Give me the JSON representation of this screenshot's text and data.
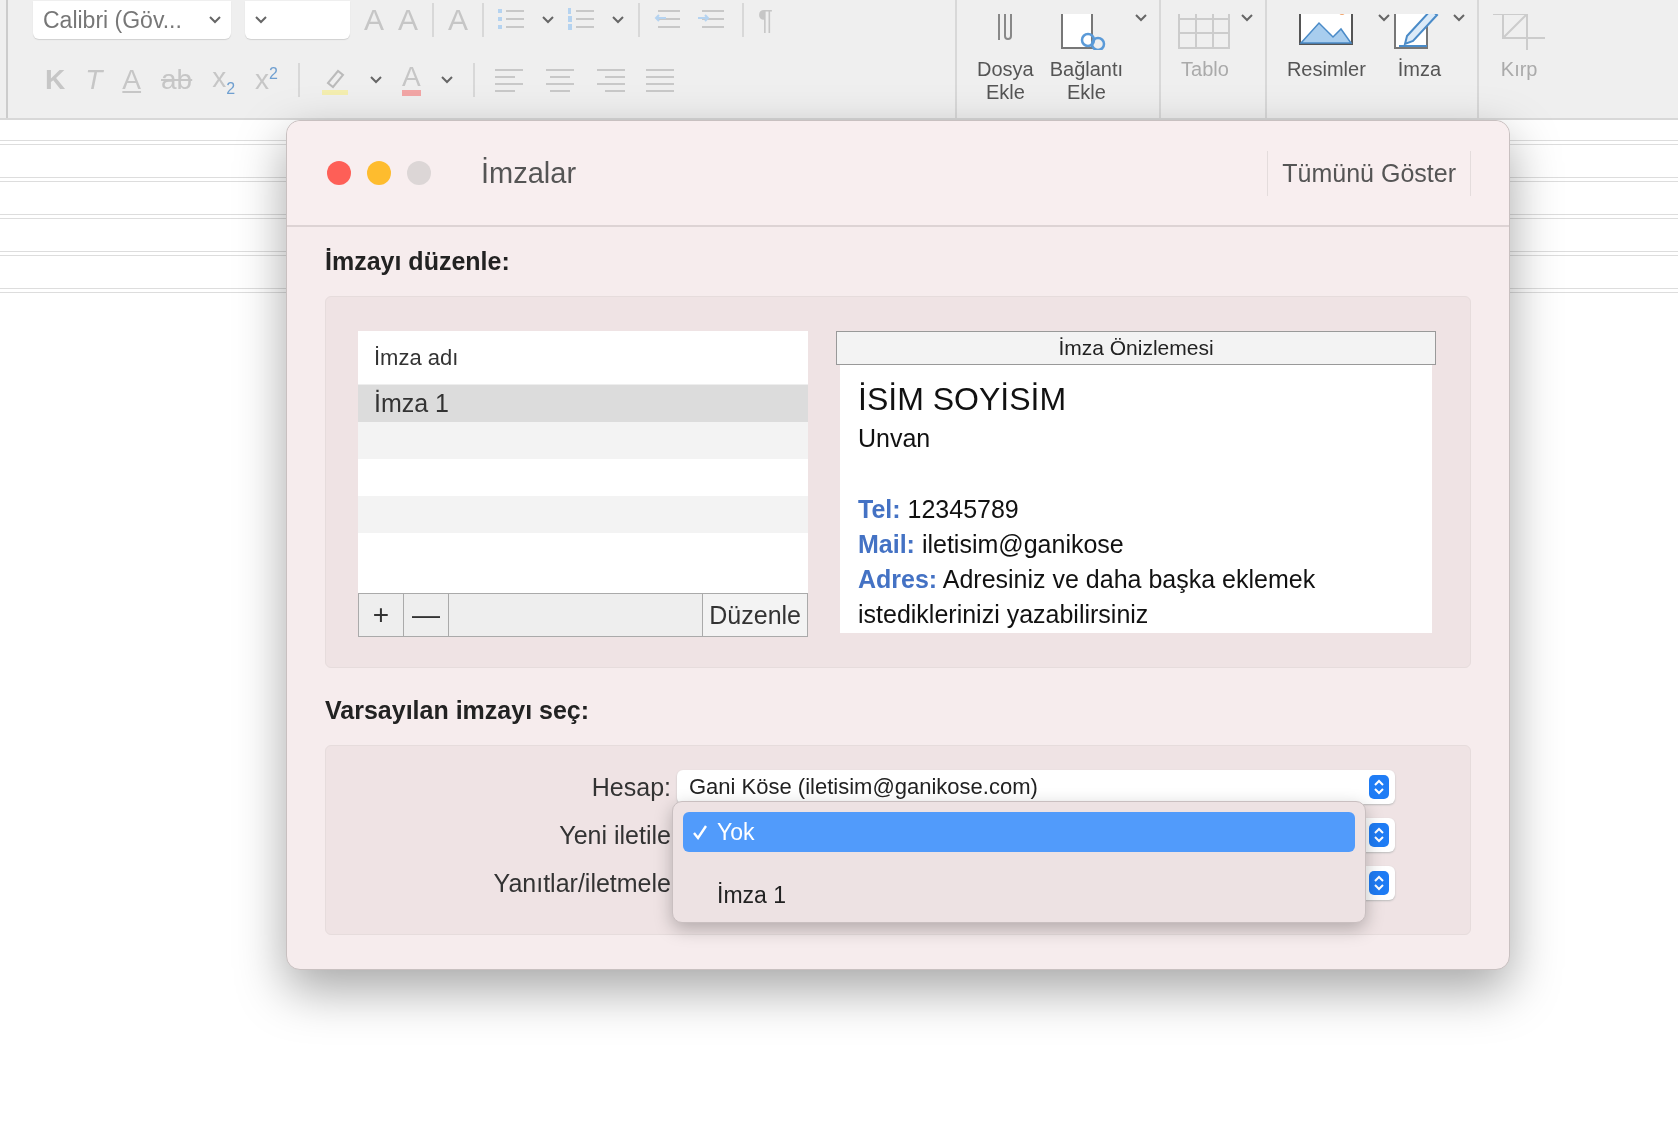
{
  "toolbar": {
    "font_field": "Calibri (Göv...",
    "row1": [
      {
        "kind": "grow",
        "label": "A"
      },
      {
        "kind": "shrink",
        "label": "A"
      },
      {
        "kind": "sep"
      },
      {
        "kind": "clear",
        "label": "A"
      },
      {
        "kind": "sep"
      },
      {
        "kind": "bullets"
      },
      {
        "kind": "numbering"
      },
      {
        "kind": "sep"
      },
      {
        "kind": "outdent"
      },
      {
        "kind": "indent"
      },
      {
        "kind": "sep"
      },
      {
        "kind": "pilcrow",
        "label": "¶"
      }
    ],
    "row2": [
      {
        "kind": "bold",
        "label": "K"
      },
      {
        "kind": "italic",
        "label": "T"
      },
      {
        "kind": "underline",
        "label": "A"
      },
      {
        "kind": "strike",
        "label": "ab"
      },
      {
        "kind": "script",
        "label": "x$_{2}$"
      },
      {
        "kind": "script",
        "label": "x$^{2}$"
      },
      {
        "kind": "sep"
      },
      {
        "kind": "highlight"
      },
      {
        "kind": "fontcolor",
        "label": "A"
      },
      {
        "kind": "sep"
      },
      {
        "kind": "align-left"
      },
      {
        "kind": "align-center"
      },
      {
        "kind": "align-right"
      },
      {
        "kind": "justify"
      }
    ],
    "big_buttons": [
      {
        "kind": "attach",
        "lines": [
          "Dosya",
          "Ekle"
        ],
        "disabled": false
      },
      {
        "kind": "link",
        "lines": [
          "Bağlantı",
          "Ekle"
        ],
        "disabled": false
      },
      {
        "kind": "table",
        "lines": [
          "Tablo"
        ],
        "disabled": true
      },
      {
        "kind": "pictures",
        "lines": [
          "Resimler"
        ],
        "disabled": false
      },
      {
        "kind": "signature",
        "lines": [
          "İmza"
        ],
        "disabled": false
      },
      {
        "kind": "crop",
        "lines": [
          "Kırp"
        ],
        "disabled": true
      }
    ]
  },
  "dialog": {
    "title": "İmzalar",
    "show_all": "Tümünü Göster",
    "edit_heading": "İmzayı düzenle:",
    "signature_list": {
      "header": "İmza adı",
      "rows": [
        {
          "name": "İmza 1",
          "selected": true
        }
      ]
    },
    "list_buttons": [
      "+",
      "—"
    ],
    "edit_button": "Düzenle",
    "preview": {
      "header": "İmza Önizlemesi",
      "name": "İSİM SOYİSİM",
      "position": "Unvan",
      "fields": [
        {
          "label": "Tel:",
          "value": "12345789"
        },
        {
          "label": "Mail:",
          "value": "iletisim@ganikose"
        },
        {
          "label": "Adres:",
          "value": "Adresiniz ve daha başka eklemek istediklerinizi yazabilirsiniz"
        }
      ]
    },
    "default_heading": "Varsayılan imzayı seç:",
    "default_rows": [
      {
        "label": "Hesap:",
        "value": "Gani Köse (iletisim@ganikose.com)"
      },
      {
        "label": "Yeni iletile"
      },
      {
        "label": "Yanıtlar/iletmele"
      }
    ],
    "menu": [
      {
        "kind": "item",
        "label": "Yok",
        "selected": true
      },
      {
        "kind": "separator"
      },
      {
        "kind": "item",
        "label": "İmza 1",
        "selected": false
      }
    ]
  }
}
